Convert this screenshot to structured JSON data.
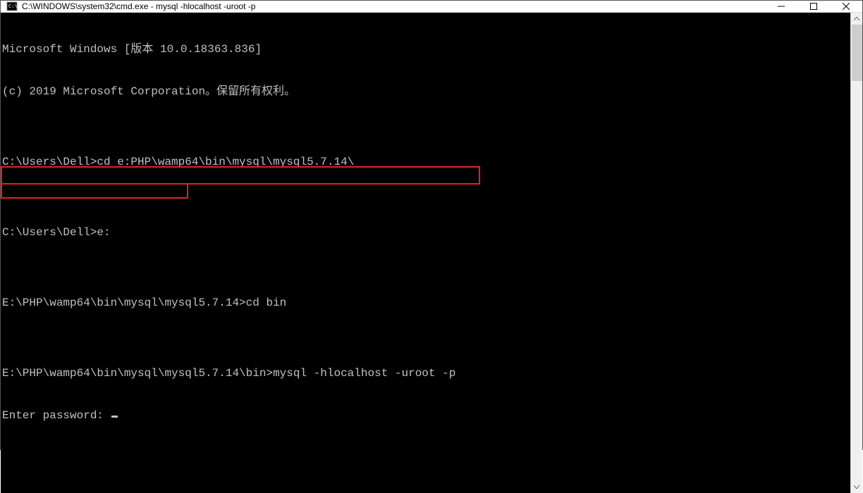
{
  "window": {
    "title": "C:\\WINDOWS\\system32\\cmd.exe - mysql  -hlocalhost -uroot -p"
  },
  "terminal": {
    "lines": [
      "Microsoft Windows [版本 10.0.18363.836]",
      "(c) 2019 Microsoft Corporation。保留所有权利。",
      "",
      "C:\\Users\\Dell>cd e:PHP\\wamp64\\bin\\mysql\\mysql5.7.14\\",
      "",
      "C:\\Users\\Dell>e:",
      "",
      "E:\\PHP\\wamp64\\bin\\mysql\\mysql5.7.14>cd bin",
      "",
      "E:\\PHP\\wamp64\\bin\\mysql\\mysql5.7.14\\bin>mysql -hlocalhost -uroot -p",
      "Enter password: "
    ]
  }
}
